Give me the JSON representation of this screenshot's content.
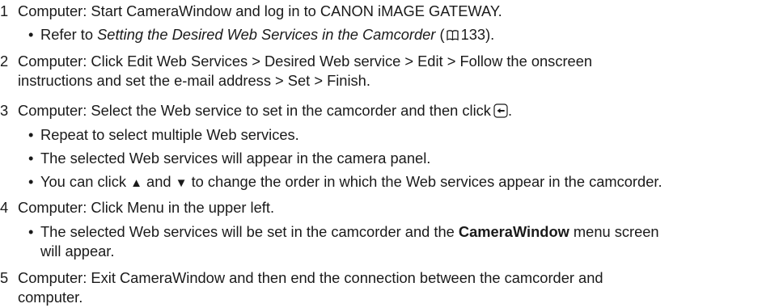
{
  "steps": [
    {
      "number": "1",
      "text": "Computer: Start CameraWindow and log in to CANON iMAGE GATEWAY.",
      "bullets": [
        {
          "prefix": "Refer to ",
          "italic": "Setting the Desired Web Services in the Camcorder",
          "ref_open": " (",
          "ref_page": "133",
          "ref_close": ")."
        }
      ]
    },
    {
      "number": "2",
      "line1": "Computer: Click Edit Web Services > Desired Web service > Edit > Follow the onscreen",
      "line2": "instructions and set the e-mail address > Set > Finish."
    },
    {
      "number": "3",
      "text": "Computer: Select the Web service to set in the camcorder and then click",
      "text_end": ".",
      "bullets": [
        "Repeat to select multiple Web services.",
        "The selected Web services will appear in the camera panel."
      ],
      "order_bullet": {
        "part1": "You can click ",
        "up": "▲",
        "part2": " and ",
        "down": "▼",
        "part3": " to change the order in which the Web services appear in the camcorder."
      }
    },
    {
      "number": "4",
      "text": "Computer: Click Menu in the upper left.",
      "bullet": {
        "part1": "The selected Web services will be set in the camcorder and the ",
        "bold": "CameraWindow",
        "part2": " menu screen",
        "line2": "will appear."
      }
    },
    {
      "number": "5",
      "line1": "Computer: Exit CameraWindow and then end the connection between the camcorder and",
      "line2": "computer."
    }
  ],
  "icons": {
    "book": "book-reference-icon",
    "upload": "upload-button-icon"
  }
}
